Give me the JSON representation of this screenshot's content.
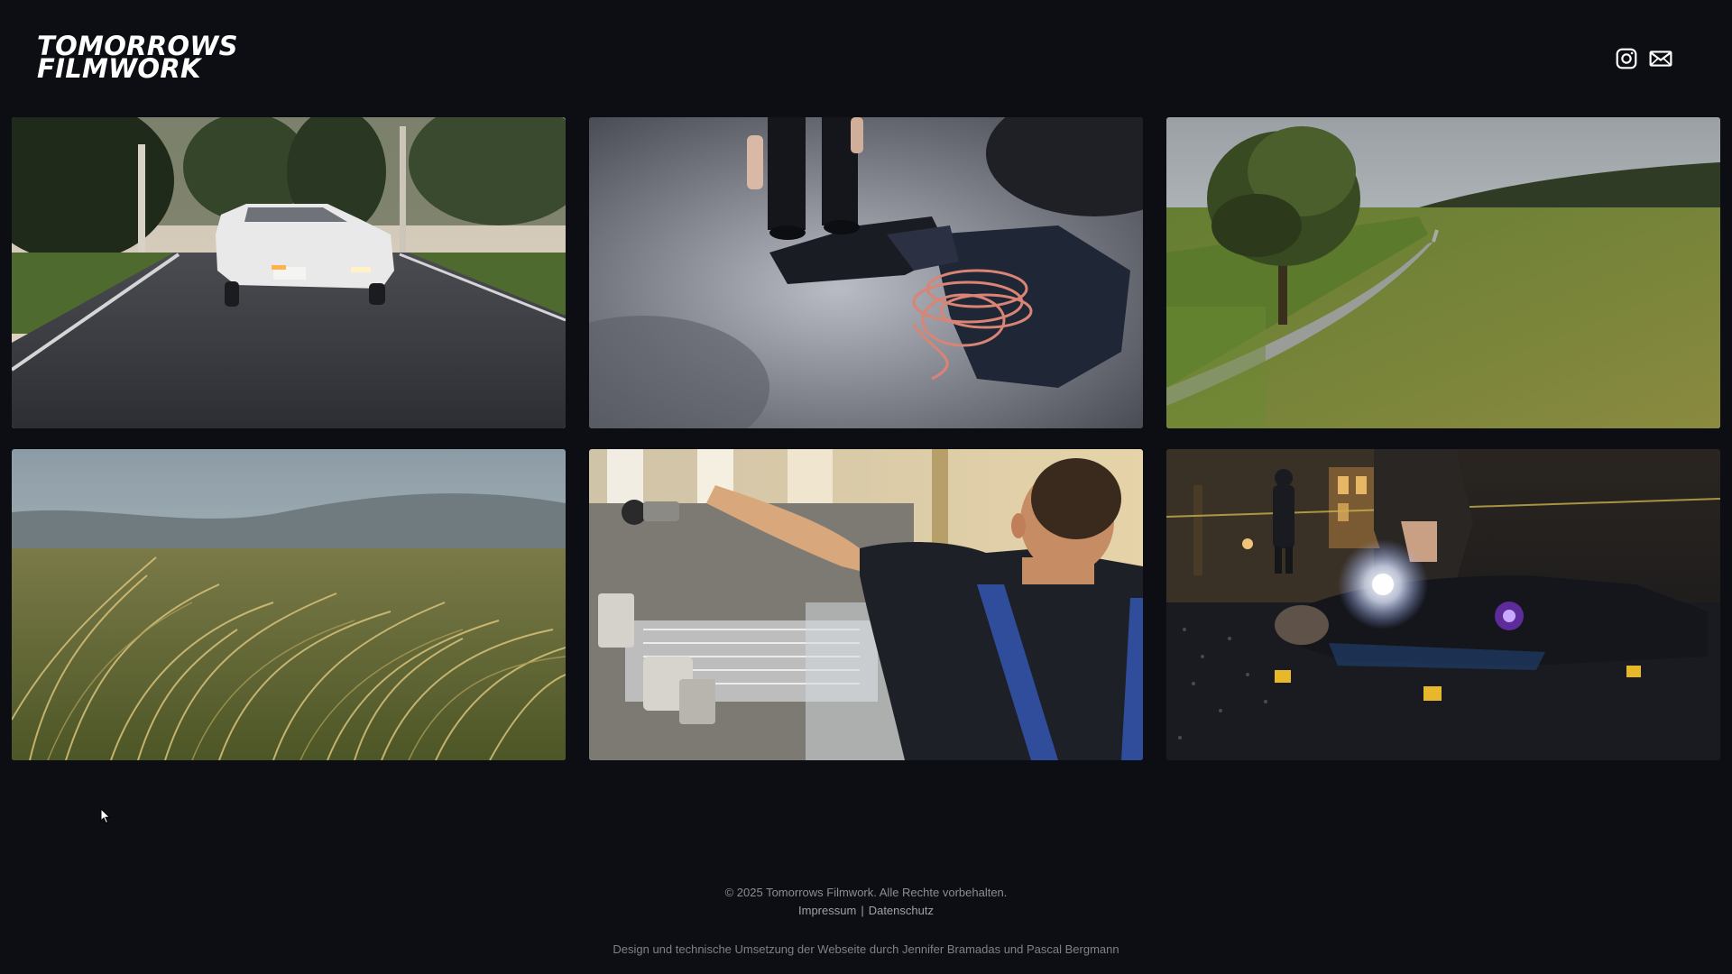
{
  "header": {
    "logo_line1": "TOMORROWS",
    "logo_line2": "FILMWORK",
    "icons": [
      "instagram-icon",
      "mail-icon"
    ]
  },
  "gallery": {
    "tiles": [
      {
        "name": "car-on-country-road"
      },
      {
        "name": "climbing-gear-on-rock"
      },
      {
        "name": "aerial-field-and-road"
      },
      {
        "name": "grass-in-wind"
      },
      {
        "name": "worker-at-machine"
      },
      {
        "name": "crime-scene-night"
      }
    ]
  },
  "footer": {
    "copyright": "© 2025 Tomorrows Filmwork. Alle Rechte vorbehalten.",
    "impressum": "Impressum",
    "separator": "|",
    "datenschutz": "Datenschutz",
    "credit": "Design und technische Umsetzung der Webseite durch Jennifer Bramadas und Pascal Bergmann"
  },
  "colors": {
    "background": "#0d0e13",
    "text": "#8b8d94",
    "logo": "#ffffff"
  }
}
